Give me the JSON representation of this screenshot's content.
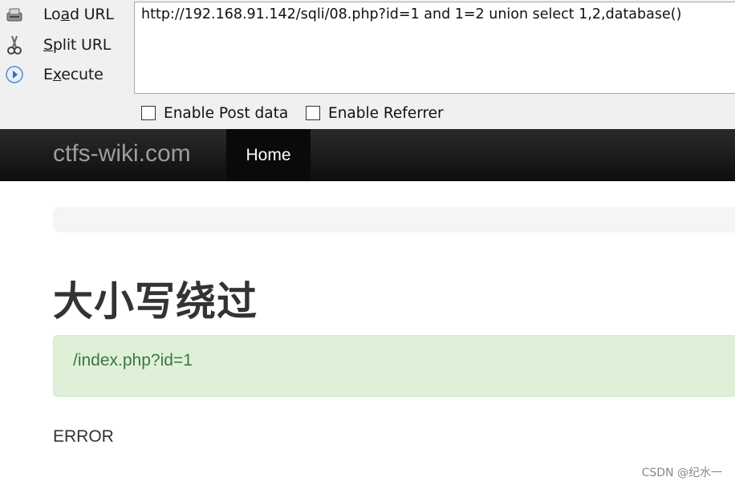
{
  "hackbar": {
    "actions": [
      {
        "label_pre": "Lo",
        "label_key": "a",
        "label_post": "d URL",
        "icon": "load-url-icon"
      },
      {
        "label_pre": "",
        "label_key": "S",
        "label_post": "plit URL",
        "icon": "scissors-icon"
      },
      {
        "label_pre": "E",
        "label_key": "x",
        "label_post": "ecute",
        "icon": "play-icon"
      }
    ],
    "url_value": "http://192.168.91.142/sqli/08.php?id=1 and 1=2 union select 1,2,database()",
    "checkboxes": [
      {
        "label": "Enable Post data",
        "checked": false
      },
      {
        "label": "Enable Referrer",
        "checked": false
      }
    ]
  },
  "navbar": {
    "brand": "ctfs-wiki.com",
    "home": "Home"
  },
  "page": {
    "title": "大小写绕过",
    "alert_text": "/index.php?id=1",
    "error_text": "ERROR"
  },
  "watermark": "CSDN @纪水一",
  "colors": {
    "navbar_bg": "#111111",
    "alert_bg": "#dff0d8",
    "alert_text": "#3c763d"
  }
}
